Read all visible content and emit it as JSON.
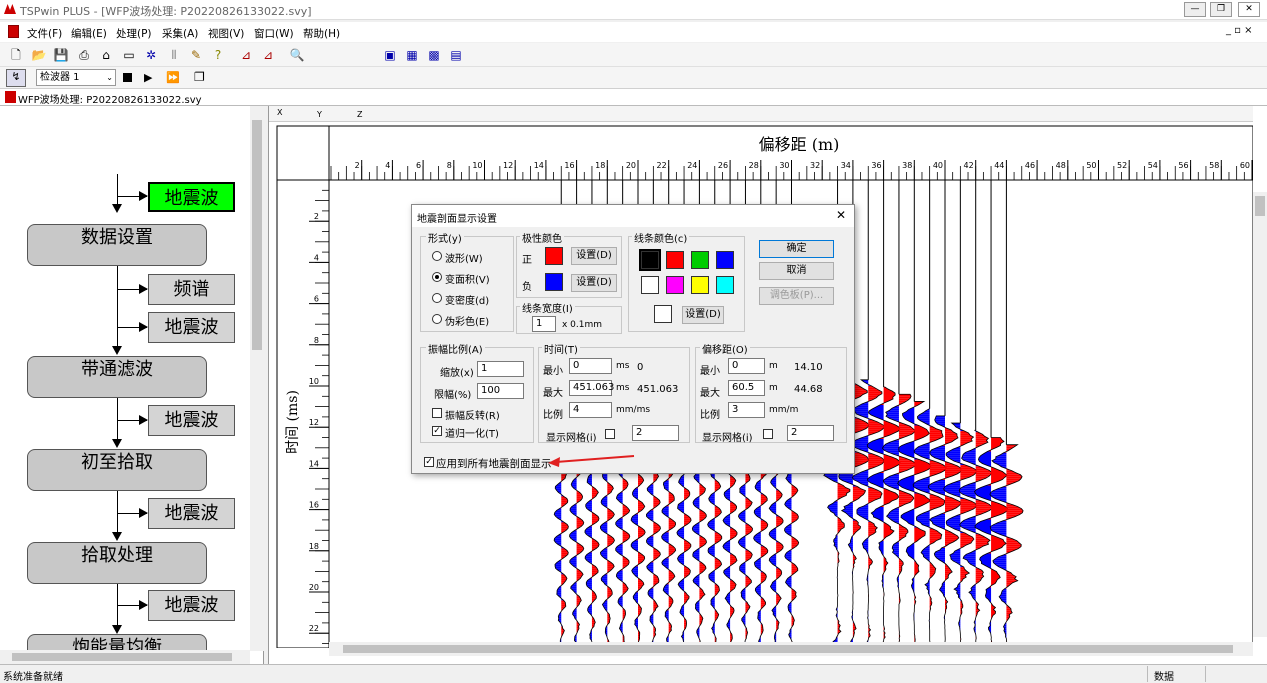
{
  "window": {
    "title": "TSPwin PLUS - [WFP波场处理: P20220826133022.svy]"
  },
  "menu": [
    "文件(F)",
    "编辑(E)",
    "处理(P)",
    "采集(A)",
    "视图(V)",
    "窗口(W)",
    "帮助(H)"
  ],
  "toolbar2": {
    "detector_select": "检波器 1"
  },
  "doc_tab": "WFP波场处理: P20220826133022.svy",
  "flow": {
    "top_sub": "地震波",
    "steps": [
      {
        "label": "数据设置",
        "subs": [
          "频谱",
          "地震波"
        ]
      },
      {
        "label": "带通滤波",
        "subs": [
          "地震波"
        ]
      },
      {
        "label": "初至拾取",
        "subs": [
          "地震波"
        ]
      },
      {
        "label": "拾取处理",
        "subs": [
          "地震波"
        ]
      },
      {
        "label": "炮能量均衡",
        "subs": []
      }
    ]
  },
  "plot": {
    "col_labels": [
      "X",
      "Y",
      "Z"
    ],
    "x_title": "偏移距 (m)",
    "y_title": "时间 (ms)",
    "x_ticks": [
      "2",
      "4",
      "6",
      "8",
      "10",
      "12",
      "14",
      "16",
      "18",
      "20",
      "22",
      "24",
      "26",
      "28",
      "30",
      "32",
      "34",
      "36",
      "38",
      "40",
      "42",
      "44",
      "46",
      "48",
      "50",
      "52",
      "54",
      "56",
      "58",
      "60"
    ],
    "y_ticks": [
      "2",
      "4",
      "6",
      "8",
      "10",
      "12",
      "14",
      "16",
      "18",
      "20",
      "22"
    ]
  },
  "dialog": {
    "title": "地震剖面显示设置",
    "form_group": "形式(y)",
    "form_options": [
      "波形(W)",
      "变面积(V)",
      "变密度(d)",
      "伪彩色(E)"
    ],
    "form_selected": 1,
    "polarity_group": "极性颜色",
    "pos_label": "正",
    "neg_label": "负",
    "set_btn": "设置(D)",
    "pos_color": "#ff0000",
    "neg_color": "#0000ff",
    "line_width_group": "线条宽度(I)",
    "line_width_value": "1",
    "line_width_unit": "x 0.1mm",
    "line_color_group": "线条颜色(c)",
    "line_colors": [
      "#000000",
      "#ff0000",
      "#00cc00",
      "#0000ff",
      "#ffffff",
      "#ff00ff",
      "#ffff00",
      "#00ffff"
    ],
    "ok": "确定",
    "cancel": "取消",
    "palette": "调色板(P)...",
    "amp_group": "振幅比例(A)",
    "scale_label": "缩放(x)",
    "scale_value": "1",
    "clip_label": "限幅(%)",
    "clip_value": "100",
    "invert_label": "振幅反转(R)",
    "normalize_label": "道归一化(T)",
    "time_group": "时间(T)",
    "min_label": "最小",
    "max_label": "最大",
    "ratio_label": "比例",
    "time_min": "0",
    "time_min_unit": "ms",
    "time_min_ref": "0",
    "time_max": "451.063",
    "time_max_unit": "ms",
    "time_max_ref": "451.063",
    "time_ratio": "4",
    "time_ratio_unit": "mm/ms",
    "grid_label": "显示网格(i)",
    "time_grid": "2",
    "offset_group": "偏移距(O)",
    "off_min": "0",
    "off_min_unit": "m",
    "off_min_ref": "14.10",
    "off_max": "60.5",
    "off_max_unit": "m",
    "off_max_ref": "44.68",
    "off_ratio": "3",
    "off_ratio_unit": "mm/m",
    "off_grid": "2",
    "apply_all": "应用到所有地震剖面显示"
  },
  "status": {
    "left": "系统准备就绪",
    "right": "数据"
  }
}
